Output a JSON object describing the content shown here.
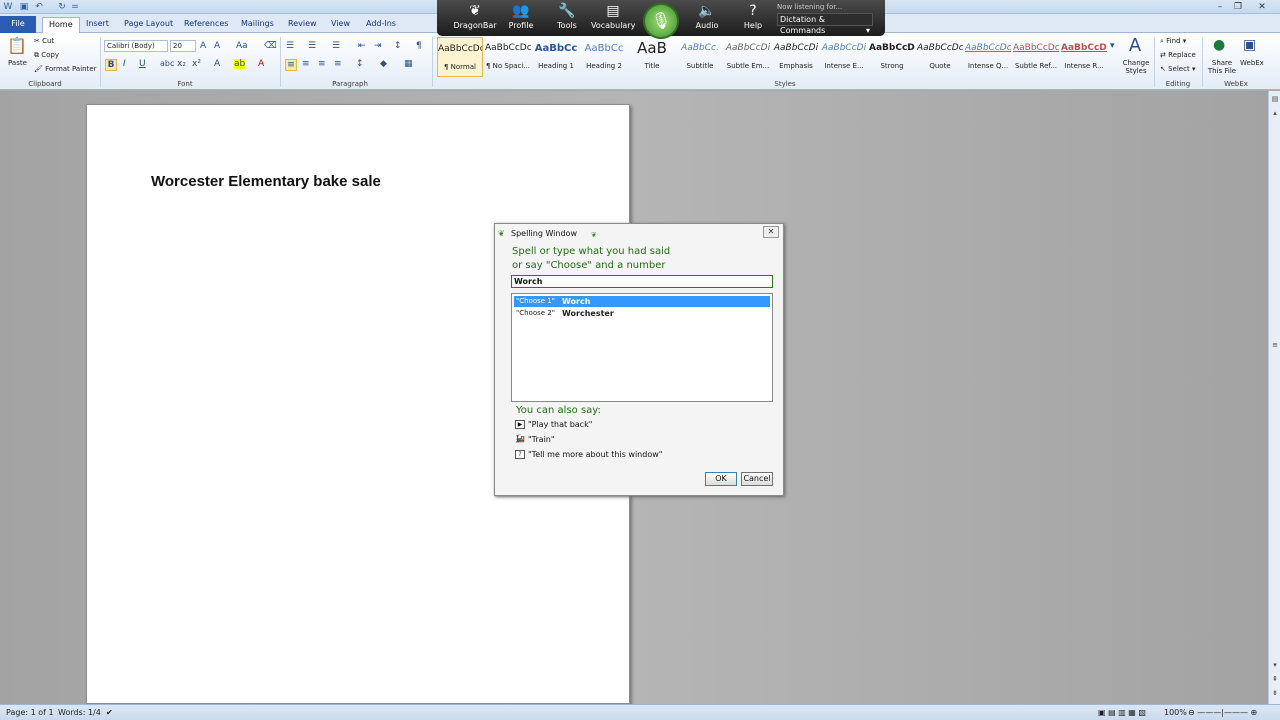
{
  "quick_access": {
    "title_hint": "="
  },
  "window_controls": {
    "minimize": "–",
    "restore": "❐",
    "close": "✕"
  },
  "tabs": [
    {
      "label": "File"
    },
    {
      "label": "Home"
    },
    {
      "label": "Insert"
    },
    {
      "label": "Page Layout"
    },
    {
      "label": "References"
    },
    {
      "label": "Mailings"
    },
    {
      "label": "Review"
    },
    {
      "label": "View"
    },
    {
      "label": "Add-Ins"
    }
  ],
  "clipboard": {
    "paste": "Paste",
    "cut": "Cut",
    "copy": "Copy",
    "format_painter": "Format Painter",
    "label": "Clipboard"
  },
  "font": {
    "name": "Calibri (Body)",
    "size": "20",
    "label": "Font"
  },
  "paragraph": {
    "label": "Paragraph"
  },
  "styles": {
    "label": "Styles",
    "items": [
      {
        "sample": "AaBbCcDc",
        "name": "¶ Normal"
      },
      {
        "sample": "AaBbCcDc",
        "name": "¶ No Spaci..."
      },
      {
        "sample": "AaBbCc",
        "name": "Heading 1"
      },
      {
        "sample": "AaBbCc",
        "name": "Heading 2"
      },
      {
        "sample": "AaB",
        "name": "Title"
      },
      {
        "sample": "AaBbCc.",
        "name": "Subtitle"
      },
      {
        "sample": "AaBbCcDi",
        "name": "Subtle Em..."
      },
      {
        "sample": "AaBbCcDi",
        "name": "Emphasis"
      },
      {
        "sample": "AaBbCcDi",
        "name": "Intense E..."
      },
      {
        "sample": "AaBbCcDc",
        "name": "Strong"
      },
      {
        "sample": "AaBbCcDc",
        "name": "Quote"
      },
      {
        "sample": "AaBbCcDc",
        "name": "Intense Q..."
      },
      {
        "sample": "AaBbCcDc",
        "name": "Subtle Ref..."
      },
      {
        "sample": "AaBbCcDc",
        "name": "Intense R..."
      }
    ],
    "change_styles": "Change Styles"
  },
  "editing": {
    "find": "Find",
    "replace": "Replace",
    "select": "Select",
    "label": "Editing"
  },
  "webex": {
    "share": "Share This File",
    "webex": "WebEx",
    "label": "WebEx"
  },
  "dragonbar": {
    "items": [
      {
        "label": "DragonBar",
        "icon": "dragon-icon"
      },
      {
        "label": "Profile",
        "icon": "profile-icon"
      },
      {
        "label": "Tools",
        "icon": "tools-icon"
      },
      {
        "label": "Vocabulary",
        "icon": "vocabulary-icon"
      },
      {
        "label": "Audio",
        "icon": "audio-icon"
      },
      {
        "label": "Help",
        "icon": "help-icon"
      }
    ],
    "listening": "Now listening for...",
    "mode": "Dictation & Commands"
  },
  "document": {
    "text": "Worcester Elementary bake sale"
  },
  "statusbar": {
    "page": "Page: 1 of 1",
    "words": "Words: 1/4",
    "zoom": "100%"
  },
  "spelling": {
    "title": "Spelling Window",
    "instruction_1": "Spell or type what you had said",
    "instruction_2": "or say \"Choose\" and a number",
    "input_value": "Worch",
    "candidates": [
      {
        "cmd": "\"Choose 1\"",
        "word": "Worch"
      },
      {
        "cmd": "\"Choose 2\"",
        "word": "Worchester"
      }
    ],
    "also_say": "You can also say:",
    "commands": [
      {
        "text": "\"Play that back\"",
        "icon": "play-icon"
      },
      {
        "text": "\"Train\"",
        "icon": "train-icon"
      },
      {
        "text": "\"Tell me more about this window\"",
        "icon": "help-icon"
      }
    ],
    "ok": "OK",
    "cancel": "Cancel"
  }
}
